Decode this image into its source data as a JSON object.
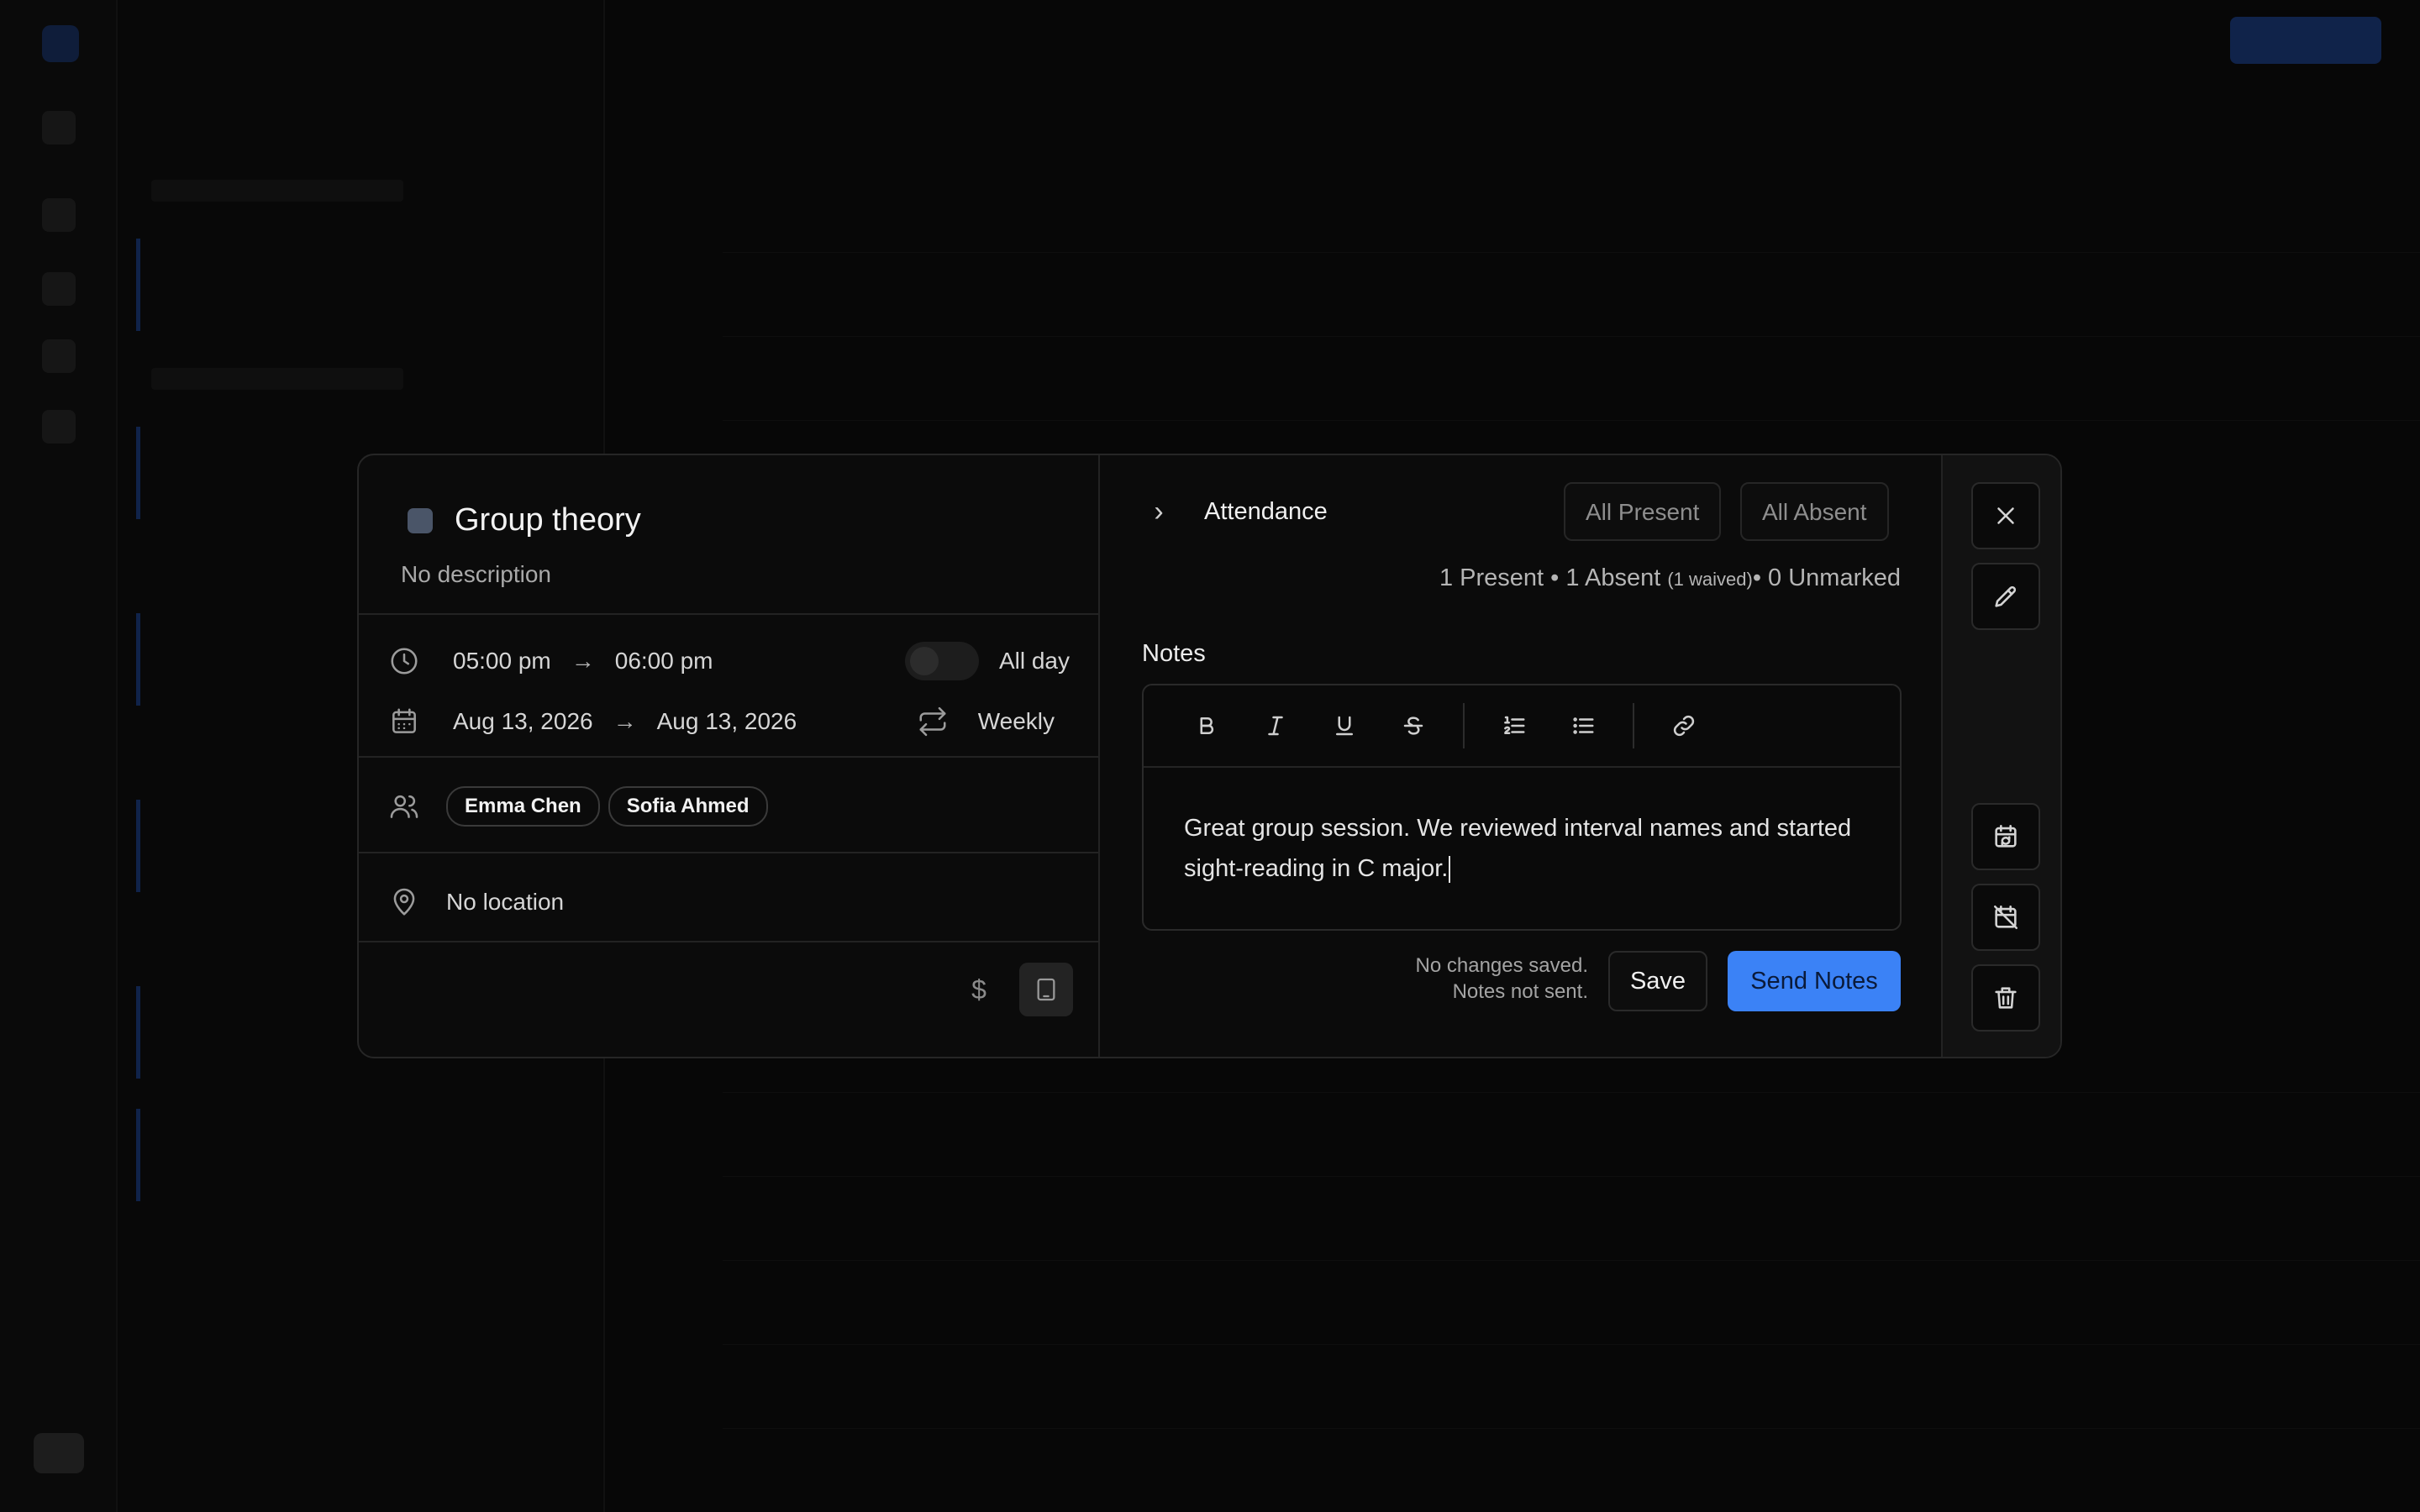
{
  "event": {
    "title": "Group theory",
    "description": "No description",
    "swatch_color": "#4a5568",
    "start_time": "05:00 pm",
    "end_time": "06:00 pm",
    "all_day_label": "All day",
    "all_day": false,
    "start_date": "Aug 13, 2026",
    "end_date": "Aug 13, 2026",
    "recurrence": "Weekly",
    "attendees": [
      "Emma Chen",
      "Sofia Ahmed"
    ],
    "location": "No location",
    "price_symbol": "$"
  },
  "attendance": {
    "title": "Attendance",
    "all_present_label": "All Present",
    "all_absent_label": "All Absent",
    "present": "1 Present",
    "bullet": "•",
    "absent": "1 Absent",
    "waived": "(1 waived)",
    "unmarked": "0 Unmarked"
  },
  "notes": {
    "label": "Notes",
    "content": "Great group session. We reviewed interval names and started sight-reading in C major.",
    "status_saved": "No changes saved.",
    "status_sent": "Notes not sent.",
    "save_label": "Save",
    "send_label": "Send Notes"
  },
  "colors": {
    "accent": "#3b82f6",
    "modal_bg": "#0b0b0b",
    "border": "#262626"
  }
}
